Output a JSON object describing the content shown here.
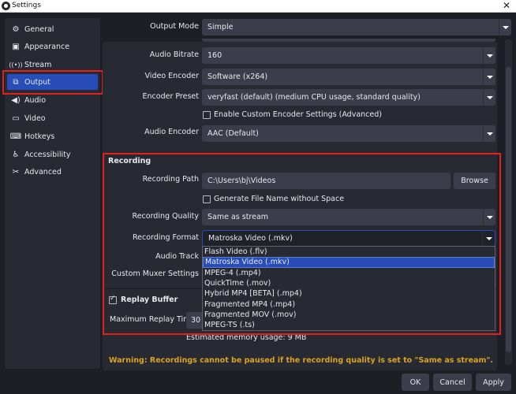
{
  "window": {
    "title": "Settings",
    "close_icon": "close-icon"
  },
  "sidebar": {
    "items": [
      {
        "label": "General",
        "icon": "gear-icon",
        "glyph": "⚙"
      },
      {
        "label": "Appearance",
        "icon": "appearance-icon",
        "glyph": "▣"
      },
      {
        "label": "Stream",
        "icon": "antenna-icon",
        "glyph": "📶"
      },
      {
        "label": "Output",
        "icon": "output-icon",
        "glyph": "⧉",
        "active": true
      },
      {
        "label": "Audio",
        "icon": "speaker-icon",
        "glyph": "🔊"
      },
      {
        "label": "Video",
        "icon": "monitor-icon",
        "glyph": "▢"
      },
      {
        "label": "Hotkeys",
        "icon": "keyboard-icon",
        "glyph": "⌨"
      },
      {
        "label": "Accessibility",
        "icon": "accessibility-icon",
        "glyph": "♿"
      },
      {
        "label": "Advanced",
        "icon": "tools-icon",
        "glyph": "✂"
      }
    ]
  },
  "output_mode": {
    "label": "Output Mode",
    "value": "Simple"
  },
  "streaming": {
    "audio_bitrate": {
      "label": "Audio Bitrate",
      "value": "160"
    },
    "video_encoder": {
      "label": "Video Encoder",
      "value": "Software (x264)"
    },
    "encoder_preset": {
      "label": "Encoder Preset",
      "value": "veryfast (default) (medium CPU usage, standard quality)"
    },
    "custom_encoder": {
      "label": "Enable Custom Encoder Settings (Advanced)",
      "checked": false
    },
    "audio_encoder": {
      "label": "Audio Encoder",
      "value": "AAC (Default)"
    }
  },
  "recording": {
    "title": "Recording",
    "path": {
      "label": "Recording Path",
      "value": "C:\\Users\\bj\\Videos",
      "browse_label": "Browse"
    },
    "no_space": {
      "label": "Generate File Name without Space",
      "checked": false
    },
    "quality": {
      "label": "Recording Quality",
      "value": "Same as stream"
    },
    "format": {
      "label": "Recording Format",
      "value": "Matroska Video (.mkv)",
      "options": [
        "Flash Video (.flv)",
        "Matroska Video (.mkv)",
        "MPEG-4 (.mp4)",
        "QuickTime (.mov)",
        "Hybrid MP4 [BETA] (.mp4)",
        "Fragmented MP4 (.mp4)",
        "Fragmented MOV (.mov)",
        "MPEG-TS (.ts)"
      ],
      "selected_index": 1
    },
    "audio_track": {
      "label": "Audio Track"
    },
    "custom_muxer": {
      "label": "Custom Muxer Settings"
    }
  },
  "replay_buffer": {
    "label": "Replay Buffer",
    "checked": true,
    "max_time_label": "Maximum Replay Time",
    "max_time_value": "30",
    "memory_usage": "Estimated memory usage: 9 MB"
  },
  "warning": "Warning: Recordings cannot be paused if the recording quality is set to \"Same as stream\".",
  "footer": {
    "ok": "OK",
    "cancel": "Cancel",
    "apply": "Apply"
  },
  "colors": {
    "accent": "#284cb8",
    "highlight_box": "#e3201b",
    "warning": "#d9a31f"
  }
}
